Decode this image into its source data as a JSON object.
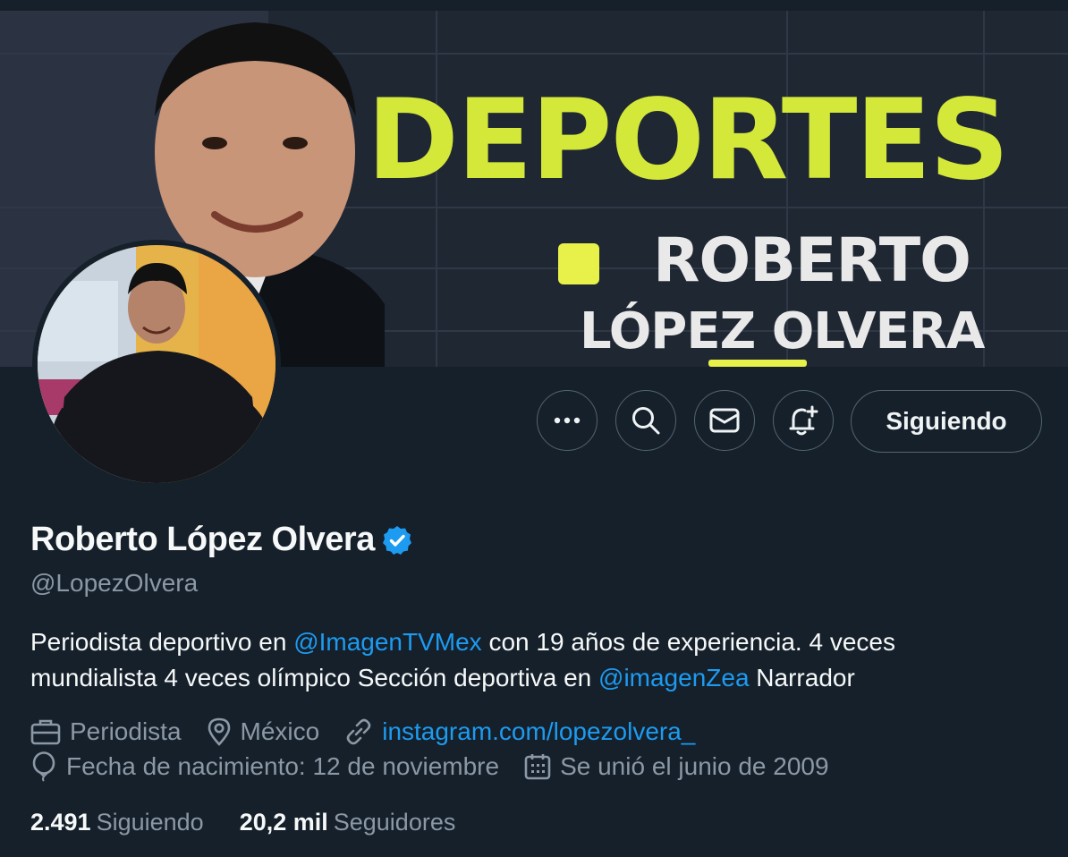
{
  "banner": {
    "headline": "DEPORTES",
    "name_line1": "ROBERTO",
    "name_line2": "LÓPEZ OLVERA"
  },
  "actions": {
    "more": "more-icon",
    "search": "search-icon",
    "message": "mail-icon",
    "notify": "bell-plus-icon",
    "following_label": "Siguiendo"
  },
  "profile": {
    "display_name": "Roberto López Olvera",
    "verified": true,
    "handle": "@LopezOlvera",
    "bio": {
      "part1": "Periodista deportivo en ",
      "mention1": "@ImagenTVMex",
      "part2": " con 19 años de experiencia. 4 veces mundialista 4 veces olímpico Sección deportiva en ",
      "mention2": "@imagenZea",
      "part3": " Narrador"
    },
    "profession": "Periodista",
    "location": "México",
    "website": "instagram.com/lopezolvera_",
    "birthday": "Fecha de nacimiento: 12 de noviembre",
    "joined": "Se unió el junio de 2009"
  },
  "stats": {
    "following_count": "2.491",
    "following_label": "Siguiendo",
    "followers_count": "20,2 mil",
    "followers_label": "Seguidores"
  },
  "colors": {
    "background": "#15202b",
    "accent": "#1d9bf0",
    "muted": "#8b98a5",
    "banner_highlight": "#d4e83a"
  }
}
